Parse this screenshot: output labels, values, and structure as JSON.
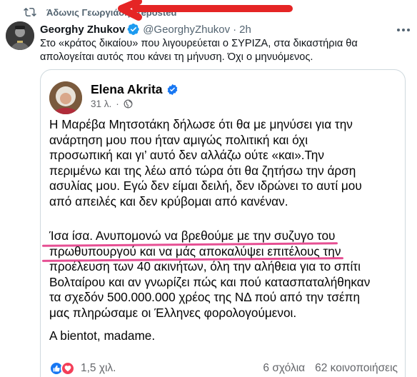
{
  "repost": {
    "text": "Άδωνις Γεωργιάδης reposted",
    "icon": "repost-icon"
  },
  "annotation_color": "#e52525",
  "tweet": {
    "author_name": "Georghy Zhukov",
    "handle": "@GeorghyZhukov",
    "separator": "·",
    "time": "2h",
    "text": "Στο «κράτος δικαίου» που λιγουρεύεται ο ΣΥΡΙΖΑ, στα δικαστήρια θα απολογείται αυτός που κάνει τη μήνυση. Όχι ο μηνυόμενος."
  },
  "fb_post": {
    "author_name": "Elena Akrita",
    "time": "31 λ.",
    "separator": "·",
    "paragraphs": [
      [
        "Η Μαρέβα Μητσοτάκη δήλωσε ότι θα με μηνύσει για την",
        "ανάρτηση μου που ήταν αμιγώς πολιτική και όχι",
        "προσωπική και γι’ αυτό δεν αλλάζω ούτε «και».Την",
        "περιμένω και της λέω από τώρα ότι θα ζητήσω την άρση",
        "ασυλίας μου. Εγώ δεν είμαι δειλή, δεν ιδρώνει το αυτί μου",
        "από απειλές και δεν κρύβομαι από κανέναν."
      ],
      [
        "Ίσα ίσα. Ανυπομονώ να βρεθούμε με την συζυγο του",
        "πρωθυπουργού και να μάς αποκαλύψει επιτέλους την",
        "προέλευση των 40 ακινήτων, όλη την αλήθεια για το σπίτι",
        "Βολταίρου και αν γνωρίζει πώς και πού κατασπαταλήθηκαν",
        "τα σχεδόν 500.000.000 χρέος της ΝΔ πού από την τσέπη",
        "μας πληρώσαμε οι Έλληνες φορολογούμενοι."
      ],
      [
        "A bientot, madame."
      ]
    ],
    "highlight_color": "#e64f93",
    "reactions_count": "1,5 χιλ.",
    "comments": "6 σχόλια",
    "shares": "62 κοινοποιήσεις"
  }
}
